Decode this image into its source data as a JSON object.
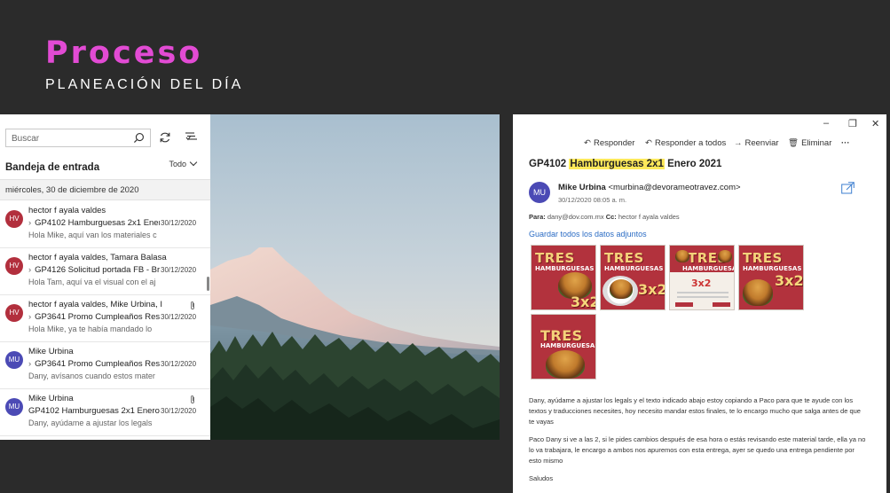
{
  "slide": {
    "title": "Proceso",
    "subtitle": "PLANEACIÓN DEL DÍA"
  },
  "inbox": {
    "search_placeholder": "Buscar",
    "title": "Bandeja de entrada",
    "filter_label": "Todo",
    "date_group": "miércoles, 30 de diciembre de 2020",
    "messages": [
      {
        "initials": "HV",
        "color": "#b22f3d",
        "from": "hector f ayala valdes",
        "subject": "GP4102 Hamburguesas 2x1 Enero",
        "date": "30/12/2020",
        "preview": "Hola Mike, aquí van los materiales c",
        "has_arrow": true,
        "attachment": false
      },
      {
        "initials": "HV",
        "color": "#b22f3d",
        "from": "hector f ayala valdes, Tamara Balasa",
        "subject": "GP4126 Solicitud portada FB - Br",
        "date": "30/12/2020",
        "preview": "Hola Tam, aquí va el visual con el aj",
        "has_arrow": true,
        "attachment": false
      },
      {
        "initials": "HV",
        "color": "#b22f3d",
        "from": "hector f ayala valdes, Mike Urbina, I",
        "subject": "GP3641 Promo Cumpleaños Rest",
        "date": "30/12/2020",
        "preview": "Hola Mike, ya te había mandado lo",
        "has_arrow": true,
        "attachment": true
      },
      {
        "initials": "MU",
        "color": "#4b4ab5",
        "from": "Mike Urbina",
        "subject": "GP3641 Promo Cumpleaños Rest",
        "date": "30/12/2020",
        "preview": "Dany, avísanos cuando estos mater",
        "has_arrow": true,
        "attachment": false
      },
      {
        "initials": "MU",
        "color": "#4b4ab5",
        "from": "Mike Urbina",
        "subject": "GP4102 Hamburguesas 2x1 Enero 2",
        "date": "30/12/2020",
        "preview": "Dany, ayúdame a ajustar los legals",
        "has_arrow": false,
        "attachment": true
      }
    ]
  },
  "reader": {
    "window_controls": [
      "–",
      "❐",
      "✕"
    ],
    "actions": {
      "reply": "Responder",
      "reply_all": "Responder a todos",
      "forward": "Reenviar",
      "delete": "Eliminar",
      "more": "···"
    },
    "subject_prefix": "GP4102",
    "subject_highlight": "Hamburguesas 2x1",
    "subject_suffix": "Enero 2021",
    "sender_initials": "MU",
    "sender_name": "Mike Urbina",
    "sender_email": "<murbina@devorameotravez.com>",
    "sent_time": "30/12/2020 08:05 a. m.",
    "to_label": "Para:",
    "to_value": "dany@dov.com.mx",
    "cc_label": "Cc:",
    "cc_value": "hector f ayala valdes",
    "save_all": "Guardar todos los datos adjuntos",
    "attachments": [
      {
        "headline": "TRES",
        "line2": "HAMBURGUESAS",
        "promo": "3x2",
        "style": "red"
      },
      {
        "headline": "TRES",
        "line2": "HAMBURGUESAS",
        "promo": "3x2",
        "style": "red"
      },
      {
        "headline": "TRES",
        "line2": "HAMBURGUESAS",
        "promo": "3x2",
        "style": "white"
      },
      {
        "headline": "TRES",
        "line2": "HAMBURGUESAS",
        "promo": "3x2",
        "style": "red"
      },
      {
        "headline": "TRES",
        "line2": "HAMBURGUESAS",
        "promo": "",
        "style": "red"
      }
    ],
    "body_p1": "Dany, ayúdame a ajustar los legals y el texto indicado abajo estoy copiando a Paco para que te ayude con los textos y traducciones necesites, hoy necesito mandar estos finales, te lo encargo mucho que salga antes de que te vayas",
    "body_p2": "Paco Dany si ve a las 2, si le pides cambios después de esa hora o estás revisando este material tarde, ella ya no lo va trabajara, le encargo a ambos nos apuremos con esta entrega, ayer se quedo una entrega pendiente por esto mismo",
    "body_p3": "Saludos"
  }
}
